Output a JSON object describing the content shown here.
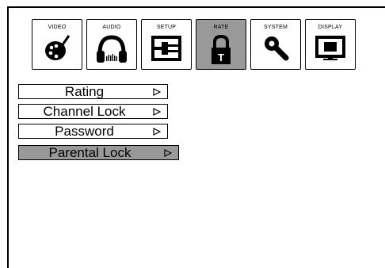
{
  "tabs": [
    {
      "label": "VIDEO",
      "icon": "video-palette-icon",
      "active": false
    },
    {
      "label": "AUDIO",
      "icon": "headphones-icon",
      "active": false
    },
    {
      "label": "SETUP",
      "icon": "setup-plug-icon",
      "active": false
    },
    {
      "label": "RATE",
      "icon": "padlock-icon",
      "active": true
    },
    {
      "label": "SYSTEM",
      "icon": "wrench-icon",
      "active": false
    },
    {
      "label": "DISPLAY",
      "icon": "monitor-icon",
      "active": false
    }
  ],
  "menu": [
    {
      "label": "Rating",
      "selected": false
    },
    {
      "label": "Channel Lock",
      "selected": false
    },
    {
      "label": "Password",
      "selected": false
    },
    {
      "label": "Parental Lock",
      "selected": true
    }
  ],
  "colors": {
    "active_bg": "#999999",
    "border": "#000000",
    "background": "#ffffff"
  }
}
